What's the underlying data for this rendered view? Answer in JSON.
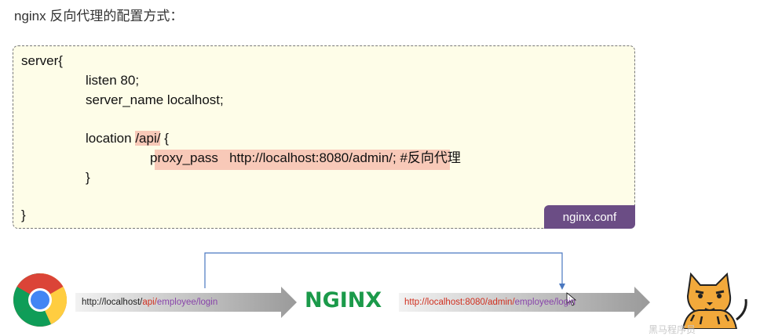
{
  "heading": "nginx 反向代理的配置方式：",
  "config": {
    "line_server_open": "server{",
    "line_listen": "listen 80;",
    "line_server_name": "server_name localhost;",
    "line_location_kw": "location ",
    "line_location_path": "/api/",
    "line_location_brace": " {",
    "line_proxy_pass": "proxy_pass   http://localhost:8080/admin/;",
    "line_comment": " #反向代理",
    "line_location_close": "}",
    "line_server_close": "}",
    "file_tag": "nginx.conf"
  },
  "flow": {
    "client_url_host": "http://localhost/",
    "client_url_api": "api/",
    "client_url_path": "employee/login",
    "nginx_label": "NGINX",
    "backend_url_host": "http://localhost:8080/admin/",
    "backend_url_path": "employee/login"
  },
  "icons": {
    "client": "chrome-browser-icon",
    "server": "tomcat-icon"
  },
  "colors": {
    "highlight": "#f8c9b8",
    "code_bg": "#fefde8",
    "tag_bg": "#6b4d85",
    "nginx_green": "#1b9a4a",
    "connector_blue": "#4a78c0"
  },
  "watermark": "黑马程序员"
}
